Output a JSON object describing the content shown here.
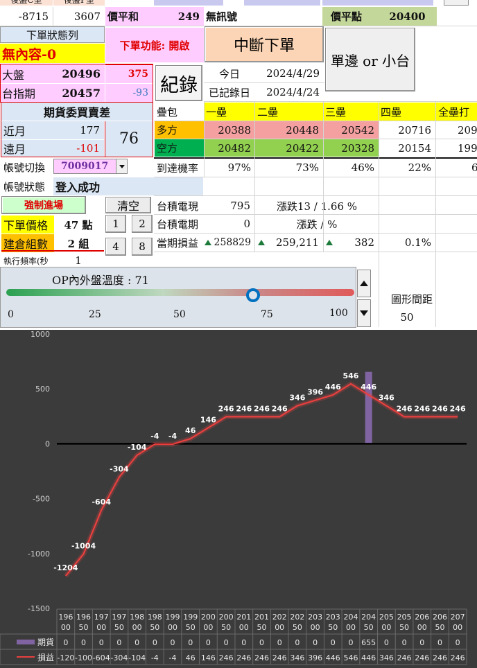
{
  "top": {
    "hdr_left1": "後盤C型",
    "hdr_left2": "後盤P型",
    "val_c": "-8715",
    "val_p": "3607",
    "price_sum_label": "價平和",
    "price_sum_value": "249",
    "no_signal": "無訊號",
    "price_point_label": "價平點",
    "price_point_value": "20400"
  },
  "order_state": {
    "label": "下單狀態列",
    "value": "無內容-0",
    "function_label": "下單功能: 開啟",
    "interrupt_button": "中斷下單",
    "single_or_small_button": "單邊 or 小台",
    "record_button": "紀錄",
    "today_label": "今日",
    "today_value": "2024/4/29",
    "recorded_label": "已記錄日",
    "recorded_value": "2024/4/24"
  },
  "market": {
    "big_label": "大盤",
    "big_value": "20496",
    "big_change": "375",
    "tx_label": "台指期",
    "tx_value": "20457",
    "tx_change": "-93"
  },
  "futures_diff": {
    "title": "期貨委買賣差",
    "near_label": "近月",
    "near_value": "177",
    "far_label": "遠月",
    "far_value": "-101",
    "total": "76"
  },
  "stack": {
    "label": "疊包",
    "headers": [
      "一壘",
      "二壘",
      "三壘",
      "四壘",
      "全壘打"
    ],
    "long_label": "多方",
    "long_values": [
      "20388",
      "20448",
      "20542",
      "20716",
      "209"
    ],
    "short_label": "空方",
    "short_values": [
      "20482",
      "20422",
      "20328",
      "20154",
      "199"
    ],
    "prob_label": "到達機率",
    "prob_values": [
      "97%",
      "73%",
      "46%",
      "22%",
      "6"
    ]
  },
  "account": {
    "switch_label": "帳號切換",
    "account_number": "7009017",
    "status_label": "帳號狀態",
    "status_value": "登入成功"
  },
  "controls": {
    "force_entry": "強制進場",
    "clear_button": "清空",
    "order_price_label": "下單價格",
    "order_price_value": "47 點",
    "position_label": "建倉組數",
    "position_value": "2 組",
    "freq_label": "執行頻率(秒",
    "freq_value": "1",
    "num_buttons": [
      "1",
      "2",
      "4",
      "8"
    ]
  },
  "pnl": {
    "cur_label": "台積電現",
    "cur_value": "795",
    "change_text": "漲跌13 / 1.66 %",
    "fut_label": "台積電期",
    "fut_value": "0",
    "fut_change_text": "漲跌 /  %",
    "period_label": "當期損益",
    "period_value1": "258829",
    "period_value2": "259,211",
    "period_value3": "382",
    "period_pct": "0.1%"
  },
  "gauge": {
    "title": "OP內外盤溫度 : 71",
    "value": 71,
    "ticks": [
      "0",
      "25",
      "50",
      "75",
      "100"
    ],
    "spacing_label": "圖形間距",
    "spacing_value": "50"
  },
  "colors": {
    "pink": "#ffccff",
    "light_blue": "#dbe7f5",
    "yellow": "#ffff00",
    "orange": "#ffc000",
    "green": "#00b050",
    "salmon": "#f4a0a0",
    "lightgreen": "#92d050",
    "chart_bg": "#3b3b3b",
    "bar": "#8064a2",
    "line": "#e8403f",
    "gauge_handle": "#0070c0"
  },
  "chart_data": {
    "type": "line",
    "ylim": [
      -1500,
      1000
    ],
    "yticks": [
      "1000",
      "500",
      "0",
      "-500",
      "-1000",
      "-1500"
    ],
    "categories": [
      "19600",
      "19650",
      "19700",
      "19750",
      "19800",
      "19850",
      "19900",
      "19950",
      "20000",
      "20050",
      "20100",
      "20150",
      "20200",
      "20250",
      "20300",
      "20350",
      "20400",
      "20450",
      "20500",
      "20550",
      "20600",
      "20650",
      "20700"
    ],
    "cat_top": [
      "196",
      "196",
      "197",
      "197",
      "198",
      "198",
      "199",
      "199",
      "200",
      "200",
      "201",
      "201",
      "202",
      "202",
      "203",
      "203",
      "204",
      "204",
      "205",
      "205",
      "206",
      "206",
      "207"
    ],
    "cat_bot": [
      "00",
      "50",
      "00",
      "50",
      "00",
      "50",
      "00",
      "50",
      "00",
      "50",
      "00",
      "50",
      "00",
      "50",
      "00",
      "50",
      "00",
      "50",
      "00",
      "50",
      "00",
      "50",
      "00"
    ],
    "series": [
      {
        "name": "期貨",
        "type": "bar",
        "values": [
          0,
          0,
          0,
          0,
          0,
          0,
          0,
          0,
          0,
          0,
          0,
          0,
          0,
          0,
          0,
          0,
          0,
          655,
          0,
          0,
          0,
          0,
          0
        ],
        "table_values": [
          "0",
          "0",
          "0",
          "0",
          "0",
          "0",
          "0",
          "0",
          "0",
          "0",
          "0",
          "0",
          "0",
          "0",
          "0",
          "0",
          "0",
          "655",
          "0",
          "0",
          "0",
          "0",
          "0"
        ]
      },
      {
        "name": "損益",
        "type": "line",
        "values": [
          -1204,
          -1004,
          -604,
          -304,
          -104,
          -4,
          -4,
          46,
          146,
          246,
          246,
          246,
          246,
          346,
          396,
          446,
          546,
          446,
          346,
          246,
          246,
          246,
          246
        ],
        "labels": [
          "-1204",
          "-1004",
          "-604",
          "-304",
          "-104",
          "-4",
          "-4",
          "46",
          "146",
          "246",
          "246",
          "246",
          "246",
          "346",
          "396",
          "446",
          "546",
          "446",
          "346",
          "246",
          "246",
          "246",
          "246"
        ],
        "table_values": [
          "-120",
          "-100",
          "-604",
          "-304",
          "-104",
          "-4",
          "-4",
          "46",
          "146",
          "246",
          "246",
          "246",
          "246",
          "346",
          "396",
          "446",
          "546",
          "446",
          "346",
          "246",
          "246",
          "246",
          "246"
        ]
      }
    ]
  }
}
